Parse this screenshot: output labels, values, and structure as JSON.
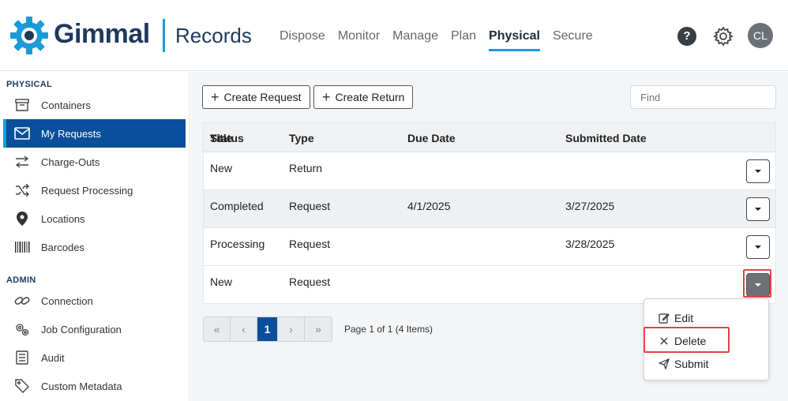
{
  "header": {
    "brand": "Gimmal",
    "app_name": "Records",
    "nav": [
      "Dispose",
      "Monitor",
      "Manage",
      "Plan",
      "Physical",
      "Secure"
    ],
    "active_nav": "Physical",
    "help_label": "?",
    "avatar_initials": "CL",
    "accent_color": "#1a9bd7",
    "brand_color": "#1d3a5c"
  },
  "sidebar": {
    "physical_label": "PHYSICAL",
    "admin_label": "ADMIN",
    "physical_items": [
      {
        "label": "Containers",
        "icon": "archive-icon"
      },
      {
        "label": "My Requests",
        "icon": "mail-icon",
        "active": true
      },
      {
        "label": "Charge-Outs",
        "icon": "swap-arrows-icon"
      },
      {
        "label": "Request Processing",
        "icon": "shuffle-icon"
      },
      {
        "label": "Locations",
        "icon": "map-pin-icon"
      },
      {
        "label": "Barcodes",
        "icon": "barcode-icon"
      }
    ],
    "admin_items": [
      {
        "label": "Connection",
        "icon": "link-icon"
      },
      {
        "label": "Job Configuration",
        "icon": "gears-icon"
      },
      {
        "label": "Audit",
        "icon": "document-list-icon"
      },
      {
        "label": "Custom Metadata",
        "icon": "tag-icon"
      }
    ]
  },
  "toolbar": {
    "create_request": "Create Request",
    "create_return": "Create Return",
    "find_placeholder": "Find"
  },
  "table": {
    "columns": {
      "status": "Status",
      "status_overlap": "Title",
      "type": "Type",
      "due_date": "Due Date",
      "submitted_date": "Submitted Date"
    },
    "rows": [
      {
        "status": "New",
        "type": "Return",
        "due_date": "",
        "submitted_date": ""
      },
      {
        "status": "Completed",
        "type": "Request",
        "due_date": "4/1/2025",
        "submitted_date": "3/27/2025"
      },
      {
        "status": "Processing",
        "type": "Request",
        "due_date": "",
        "submitted_date": "3/28/2025"
      },
      {
        "status": "New",
        "type": "Request",
        "due_date": "",
        "submitted_date": ""
      }
    ]
  },
  "pagination": {
    "first": "«",
    "prev": "‹",
    "current": "1",
    "next": "›",
    "last": "»",
    "info": "Page 1 of 1 (4 Items)"
  },
  "row_menu": {
    "items": [
      {
        "label": "Edit",
        "icon": "edit-icon"
      },
      {
        "label": "Delete",
        "icon": "close-icon"
      },
      {
        "label": "Submit",
        "icon": "send-icon"
      }
    ]
  }
}
